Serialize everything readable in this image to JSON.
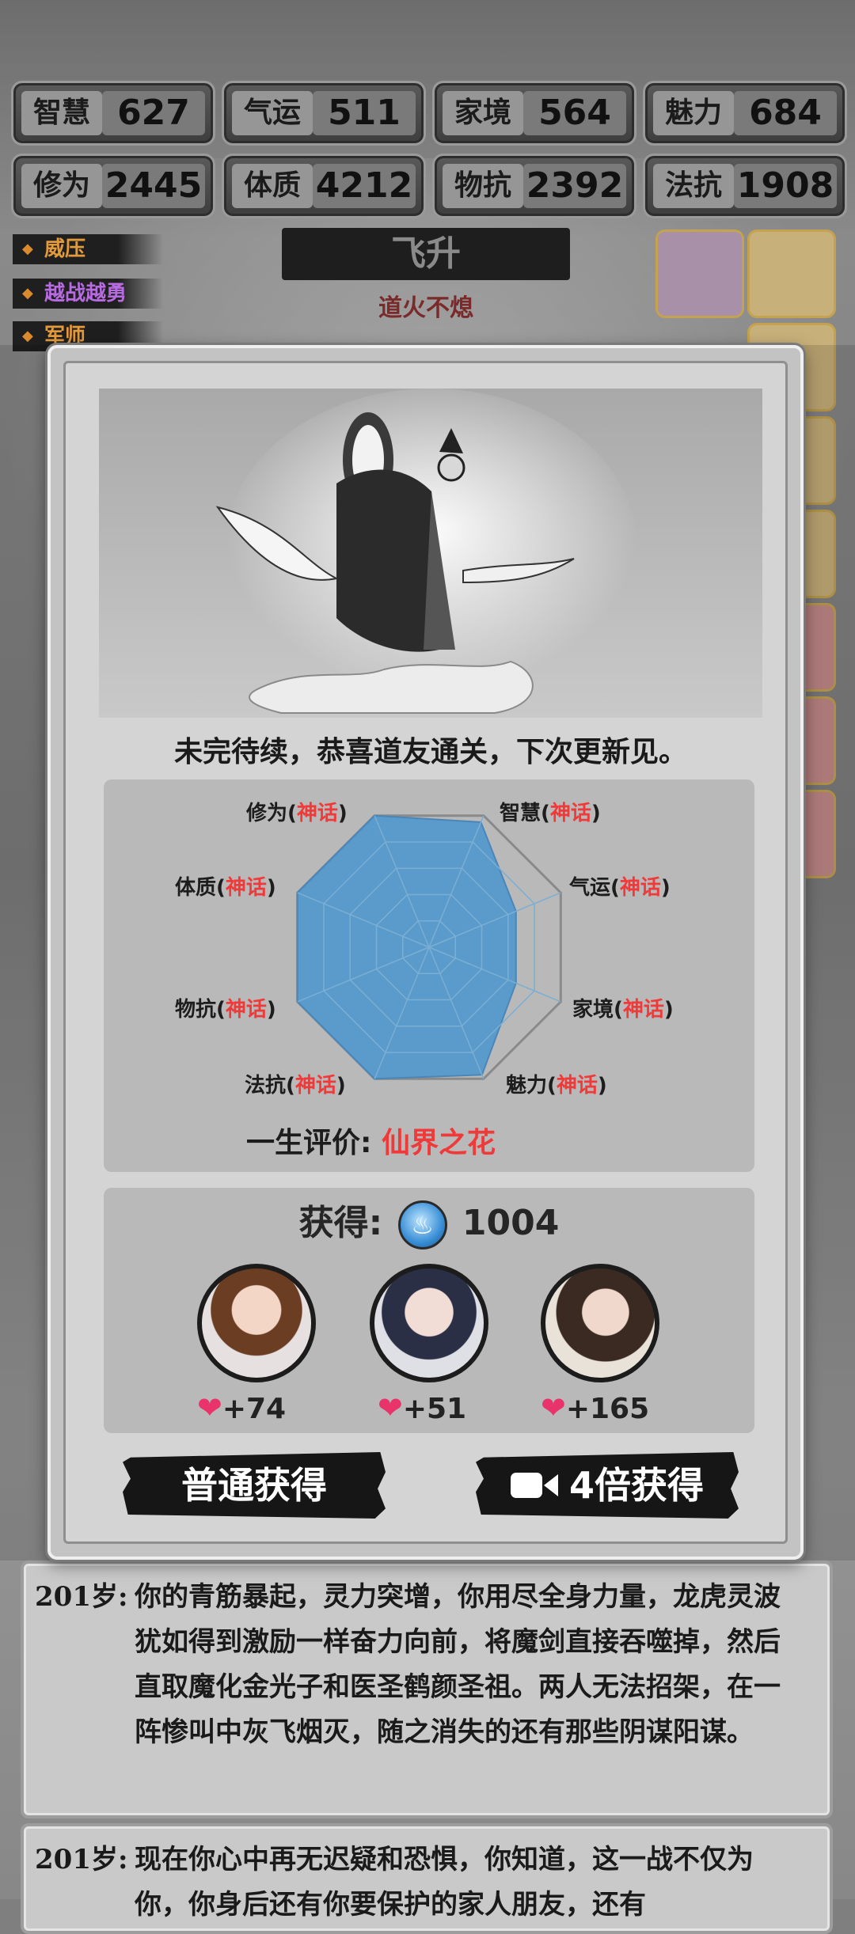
{
  "stats": [
    {
      "label": "智慧",
      "value": "627"
    },
    {
      "label": "气运",
      "value": "511"
    },
    {
      "label": "家境",
      "value": "564"
    },
    {
      "label": "魅力",
      "value": "684"
    },
    {
      "label": "修为",
      "value": "2445"
    },
    {
      "label": "体质",
      "value": "4212"
    },
    {
      "label": "物抗",
      "value": "2392"
    },
    {
      "label": "法抗",
      "value": "1908"
    }
  ],
  "traits": [
    {
      "label": "威压",
      "color": "#e39a3a"
    },
    {
      "label": "越战越勇",
      "color": "#b76be0"
    },
    {
      "label": "军师",
      "color": "#e39a3a"
    }
  ],
  "realm": {
    "title": "飞升",
    "subtitle": "道火不熄"
  },
  "modal": {
    "message": "未完待续，恭喜道友通关，下次更新见。",
    "radar": {
      "labels": [
        {
          "name": "修为",
          "open": "(",
          "quality": "神话",
          "close": ")"
        },
        {
          "name": "智慧",
          "open": "(",
          "quality": "神话",
          "close": ")"
        },
        {
          "name": "气运",
          "open": "(",
          "quality": "神话",
          "close": ")"
        },
        {
          "name": "家境",
          "open": "(",
          "quality": "神话",
          "close": ")"
        },
        {
          "name": "魅力",
          "open": "(",
          "quality": "神话",
          "close": ")"
        },
        {
          "name": "法抗",
          "open": "(",
          "quality": "神话",
          "close": ")"
        },
        {
          "name": "物抗",
          "open": "(",
          "quality": "神话",
          "close": ")"
        },
        {
          "name": "体质",
          "open": "(",
          "quality": "神话",
          "close": ")"
        }
      ],
      "levels": [
        1.0,
        0.95,
        0.66,
        0.66,
        0.97,
        1.0,
        1.0,
        1.0
      ]
    },
    "evaluation_label": "一生评价:",
    "evaluation_value": "仙界之花",
    "reward_label": "获得:",
    "reward_icon": "spirit-flame-icon",
    "reward_amount": "1004",
    "companions": [
      {
        "affection": "+74"
      },
      {
        "affection": "+51"
      },
      {
        "affection": "+165"
      }
    ],
    "normal_button": "普通获得",
    "video_button": "4倍获得",
    "video_icon": "video-camera-icon"
  },
  "log": [
    {
      "age": "201岁:",
      "text": "你的青筋暴起，灵力突增，你用尽全身力量，龙虎灵波犹如得到激励一样奋力向前，将魔剑直接吞噬掉，然后直取魔化金光子和医圣鹤颜圣祖。两人无法招架，在一阵惨叫中灰飞烟灭，随之消失的还有那些阴谋阳谋。"
    },
    {
      "age": "201岁:",
      "text": "现在你心中再无迟疑和恐惧，你知道，这一战不仅为你，你身后还有你要保护的家人朋友，还有"
    }
  ],
  "colors": {
    "accent_red": "#f03a3a",
    "heart": "#e8336b",
    "radar_fill": "#5b9bcb"
  }
}
